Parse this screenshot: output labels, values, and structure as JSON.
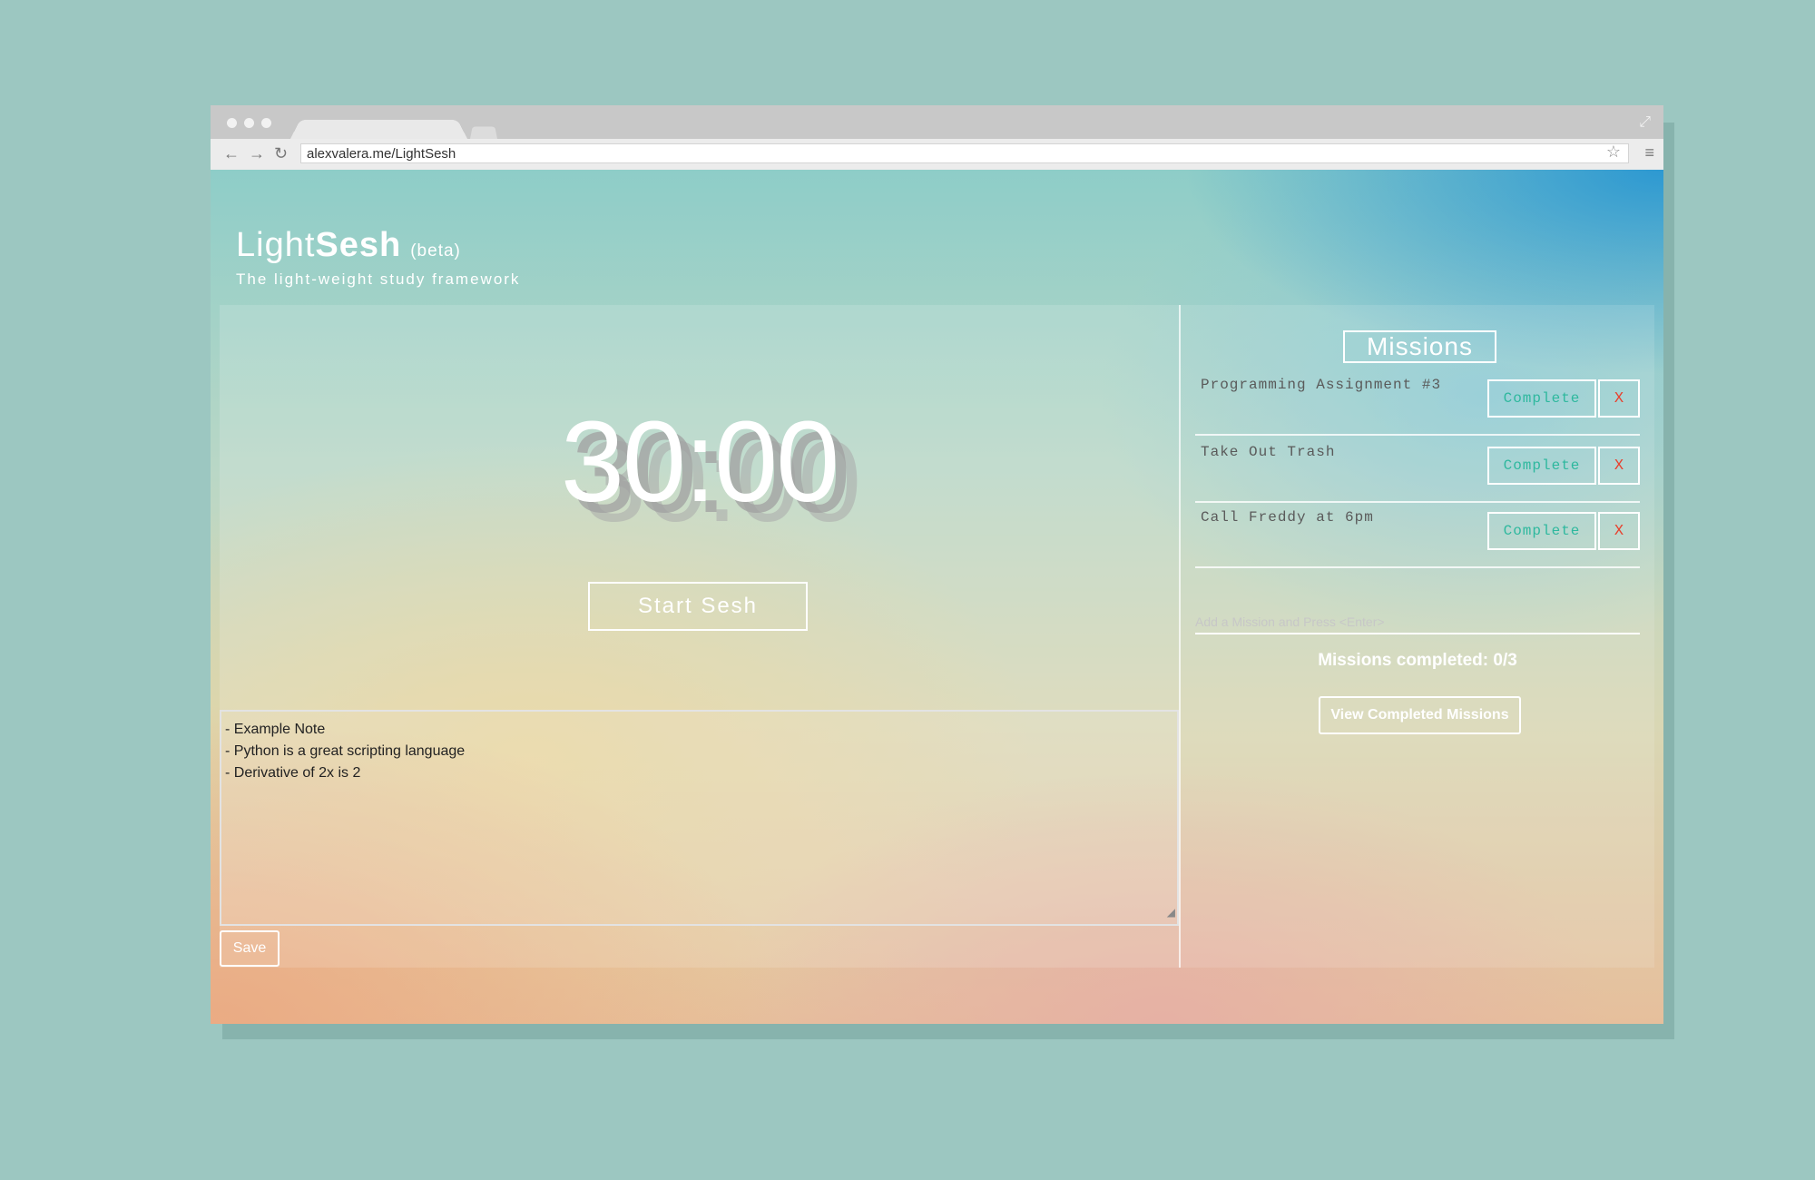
{
  "browser": {
    "url": "alexvalera.me/LightSesh",
    "icons": {
      "back": "arrow-left-icon",
      "forward": "arrow-right-icon",
      "reload": "reload-icon",
      "bookmark": "star-icon",
      "menu": "hamburger-menu-icon",
      "expand": "expand-icon"
    }
  },
  "app": {
    "title_light": "Light",
    "title_bold": "Sesh",
    "beta": "(beta)",
    "tagline": "The light-weight study framework"
  },
  "timer": {
    "display": "30:00",
    "start_label": "Start Sesh"
  },
  "notes": {
    "lines": [
      "- Example Note",
      "- Python is a great scripting language",
      "- Derivative of 2x is 2"
    ],
    "save_label": "Save"
  },
  "missions": {
    "title": "Missions",
    "items": [
      {
        "name": "Programming Assignment #3",
        "complete_label": "Complete",
        "remove_label": "X"
      },
      {
        "name": "Take Out Trash",
        "complete_label": "Complete",
        "remove_label": "X"
      },
      {
        "name": "Call Freddy at 6pm",
        "complete_label": "Complete",
        "remove_label": "X"
      }
    ],
    "input_placeholder": "Add a Mission and Press <Enter>",
    "completed_text": "Missions completed: 0/3",
    "view_completed_label": "View Completed Missions"
  },
  "colors": {
    "complete": "#2eb89e",
    "remove": "#e8412e",
    "background": "#9cc7c1"
  }
}
